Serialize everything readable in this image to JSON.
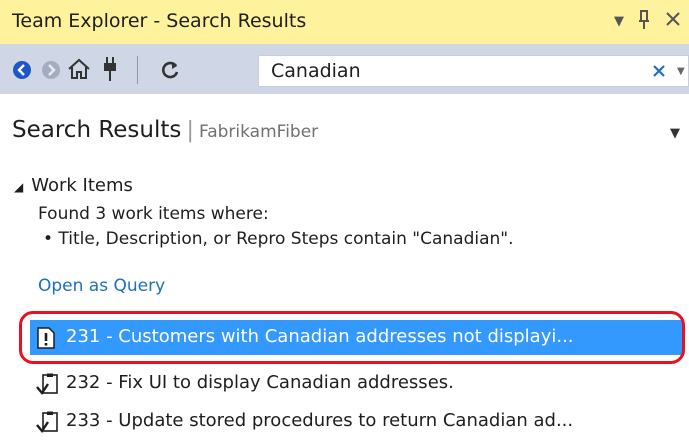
{
  "window": {
    "title": "Team Explorer - Search Results"
  },
  "search": {
    "value": "Canadian"
  },
  "page": {
    "title": "Search Results",
    "separator": "|",
    "project": "FabrikamFiber"
  },
  "work_items": {
    "section_label": "Work Items",
    "found_text": "Found 3 work items where:",
    "criteria_text": "• Title, Description, or Repro Steps contain \"Canadian\".",
    "open_query_label": "Open as Query",
    "items": [
      {
        "label": "231 - Customers with Canadian addresses not displayi..."
      },
      {
        "label": "232 - Fix UI to display Canadian addresses."
      },
      {
        "label": "233 - Update stored procedures to return Canadian ad..."
      }
    ]
  },
  "colors": {
    "titlebar_bg": "#fff29d",
    "toolbar_bg": "#cfd6e5",
    "selection_bg": "#3399ff",
    "link": "#1e6fc1",
    "highlight_ring": "#e81123"
  }
}
